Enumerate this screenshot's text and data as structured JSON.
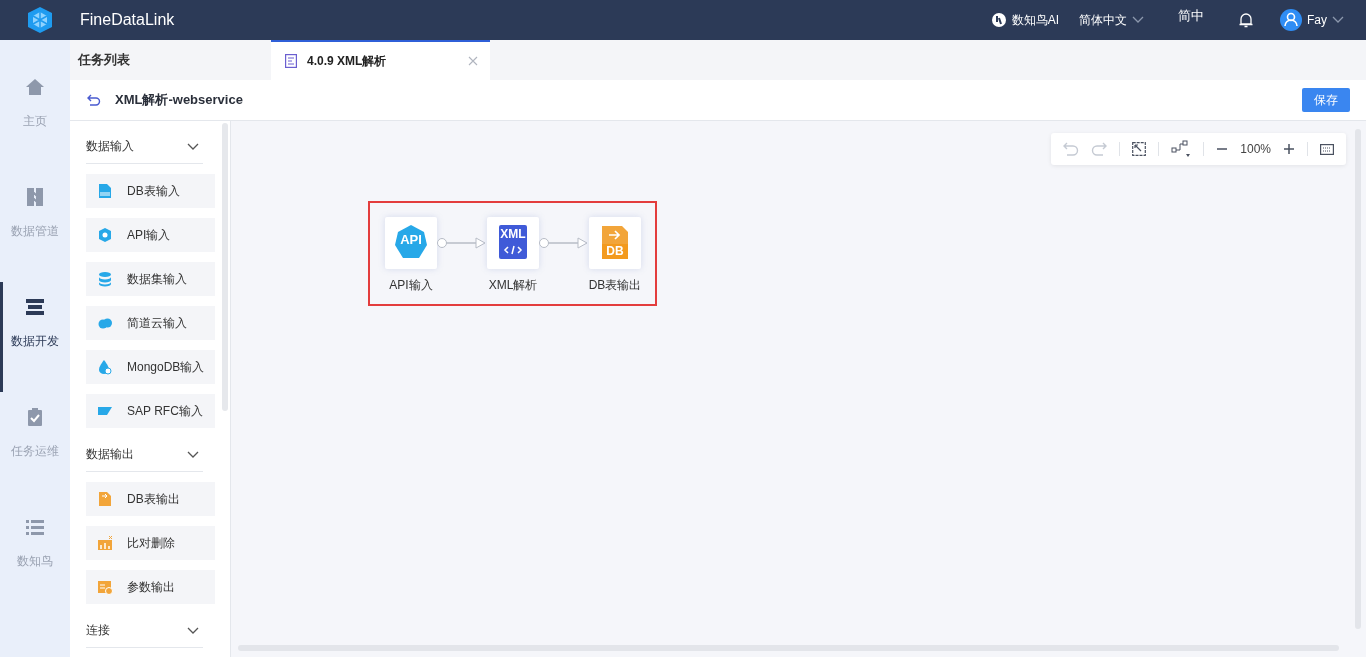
{
  "app": {
    "name": "FineDataLink"
  },
  "topbar": {
    "ai": "数知鸟AI",
    "language": "简体中文",
    "lang_short": "简中",
    "user": "Fay"
  },
  "nav": [
    {
      "label": "主页",
      "kind": "home",
      "selected": false
    },
    {
      "label": "数据管道",
      "kind": "pipe",
      "selected": false
    },
    {
      "label": "数据开发",
      "kind": "dev",
      "selected": true
    },
    {
      "label": "任务运维",
      "kind": "ops",
      "selected": false
    },
    {
      "label": "数知鸟",
      "kind": "list",
      "selected": false
    }
  ],
  "task_list": {
    "title": "任务列表"
  },
  "tabs": [
    {
      "label": "4.0.9 XML解析",
      "selected": true
    }
  ],
  "header": {
    "title": "XML解析-webservice",
    "save": "保存"
  },
  "palette": [
    {
      "title": "数据输入",
      "expanded": true,
      "items": [
        {
          "label": "DB表输入",
          "kind": "db-in"
        },
        {
          "label": "API输入",
          "kind": "api"
        },
        {
          "label": "数据集输入",
          "kind": "dataset"
        },
        {
          "label": "简道云输入",
          "kind": "cloud"
        },
        {
          "label": "MongoDB输入",
          "kind": "mongo"
        },
        {
          "label": "SAP RFC输入",
          "kind": "sap"
        }
      ]
    },
    {
      "title": "数据输出",
      "expanded": true,
      "items": [
        {
          "label": "DB表输出",
          "kind": "db-out"
        },
        {
          "label": "比对删除",
          "kind": "compare"
        },
        {
          "label": "参数输出",
          "kind": "param"
        }
      ]
    },
    {
      "title": "连接",
      "expanded": true
    }
  ],
  "toolbar": {
    "zoom": "100%"
  },
  "flow": {
    "nodes": [
      {
        "label": "API输入",
        "kind": "api",
        "icon_text": "API"
      },
      {
        "label": "XML解析",
        "kind": "xml",
        "icon_text": "XML"
      },
      {
        "label": "DB表输出",
        "kind": "db-out",
        "icon_text": "DB"
      }
    ]
  }
}
